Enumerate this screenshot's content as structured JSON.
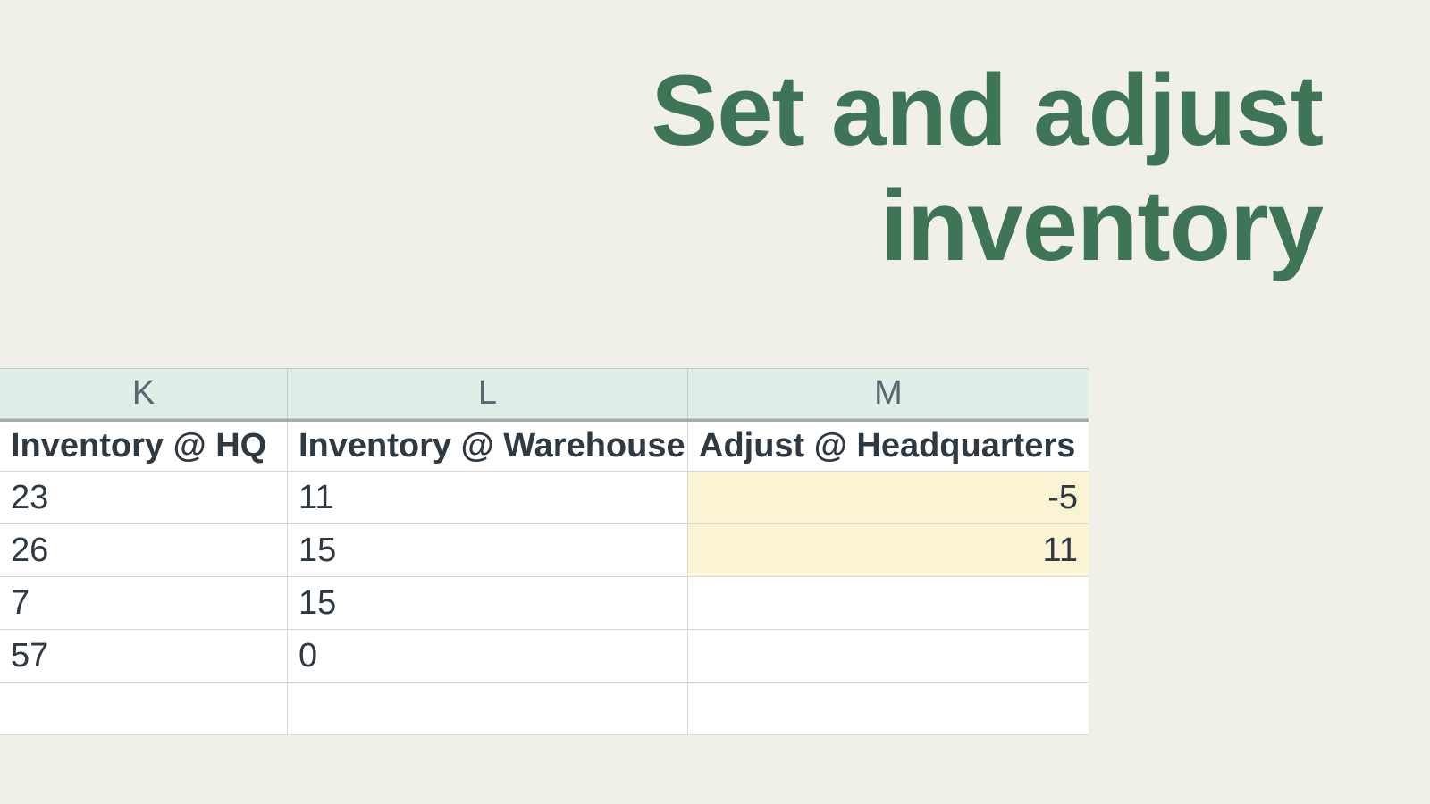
{
  "title_line1": "Set and adjust",
  "title_line2": "inventory",
  "columns": {
    "k_letter": "K",
    "l_letter": "L",
    "m_letter": "M",
    "k_header": "Inventory @ HQ",
    "l_header": "Inventory @ Warehouse",
    "m_header": "Adjust @ Headquarters"
  },
  "rows": [
    {
      "k": "23",
      "l": "11",
      "m": "-5",
      "m_highlighted": true
    },
    {
      "k": "26",
      "l": "15",
      "m": "11",
      "m_highlighted": true
    },
    {
      "k": "7",
      "l": "15",
      "m": "",
      "m_highlighted": false
    },
    {
      "k": "57",
      "l": "0",
      "m": "",
      "m_highlighted": false
    },
    {
      "k": "",
      "l": "",
      "m": "",
      "m_highlighted": false
    }
  ]
}
